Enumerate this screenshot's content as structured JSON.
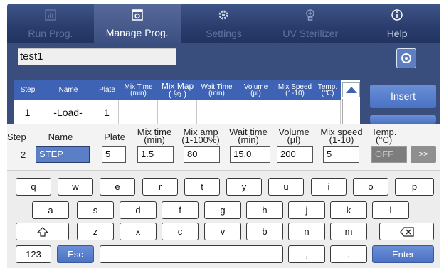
{
  "nav": {
    "tabs": [
      {
        "label": "Run Prog.",
        "icon": "chart-icon",
        "active": false
      },
      {
        "label": "Manage Prog.",
        "icon": "settings-box-icon",
        "active": true
      },
      {
        "label": "Settings",
        "icon": "gear-icon",
        "active": false
      },
      {
        "label": "UV Sterilizer",
        "icon": "lightbulb-icon",
        "active": false
      },
      {
        "label": "Help",
        "icon": "info-icon",
        "active": false
      }
    ]
  },
  "program": {
    "name": "test1",
    "action_icon": "circle-target-icon"
  },
  "table": {
    "headers": [
      {
        "line1": "Step",
        "line2": ""
      },
      {
        "line1": "Name",
        "line2": ""
      },
      {
        "line1": "Plate",
        "line2": ""
      },
      {
        "line1": "Mix Time",
        "line2": "(min)"
      },
      {
        "line1": "Mix Map",
        "line2": "( % )"
      },
      {
        "line1": "Wait Time",
        "line2": "(min)"
      },
      {
        "line1": "Volume",
        "line2": "(µl)"
      },
      {
        "line1": "Mix Speed",
        "line2": "(1-10)"
      },
      {
        "line1": "Temp.",
        "line2": "(℃)"
      }
    ],
    "rows": [
      {
        "step": "1",
        "name": "-Load-",
        "plate": "1",
        "mix_time": "",
        "mix_map": "",
        "wait_time": "",
        "volume": "",
        "mix_speed": "",
        "temp": ""
      }
    ]
  },
  "side_buttons": {
    "insert": "Insert",
    "next": ""
  },
  "edit": {
    "labels": {
      "step": "Step",
      "name": "Name",
      "plate": "Plate",
      "mix_time": "Mix time",
      "mix_time_unit": "(min)",
      "mix_amp": "Mix amp",
      "mix_amp_unit": "(1-100%)",
      "wait_time": "Wait time",
      "wait_time_unit": "(min)",
      "volume": "Volume",
      "volume_unit": "(µl)",
      "mix_speed": "Mix speed",
      "mix_speed_unit": "(1-10)",
      "temp": "Temp.",
      "temp_unit": "(°C)"
    },
    "values": {
      "step": "2",
      "name": "STEP",
      "plate": "5",
      "mix_time": "1.5",
      "mix_amp": "80",
      "wait_time": "15.0",
      "volume": "200",
      "mix_speed": "5",
      "temp": "OFF"
    },
    "more_label": ">>"
  },
  "keyboard": {
    "row1": [
      "q",
      "w",
      "e",
      "r",
      "t",
      "y",
      "u",
      "i",
      "o",
      "p"
    ],
    "row2": [
      "a",
      "s",
      "d",
      "f",
      "g",
      "h",
      "j",
      "k",
      "l"
    ],
    "row3": [
      "z",
      "x",
      "c",
      "v",
      "b",
      "n",
      "m"
    ],
    "numbers_label": "123",
    "esc_label": "Esc",
    "comma_label": ",",
    "period_label": ".",
    "enter_label": "Enter",
    "shift_icon": "shift-arrow-icon",
    "backspace_icon": "backspace-icon"
  },
  "colors": {
    "nav_bg": "#2a3c6c",
    "accent_blue": "#4a72c4",
    "header_blue": "#3f63b4"
  }
}
